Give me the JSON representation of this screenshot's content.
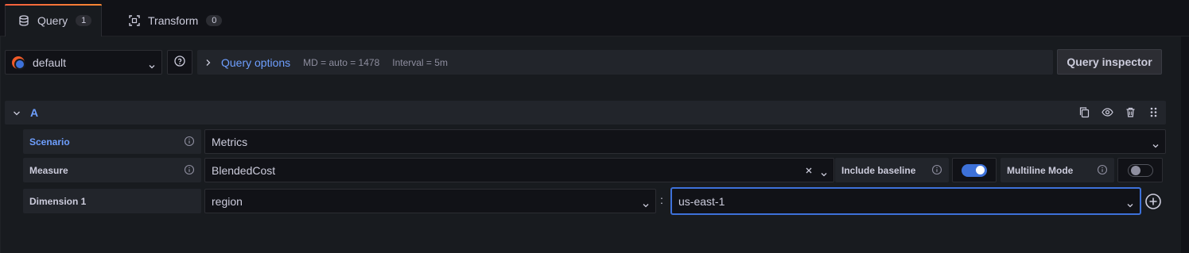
{
  "tabs": [
    {
      "label": "Query",
      "count": "1"
    },
    {
      "label": "Transform",
      "count": "0"
    }
  ],
  "toolbar": {
    "datasource": "default",
    "query_options_label": "Query options",
    "md": "MD = auto = 1478",
    "interval": "Interval = 5m",
    "inspector_label": "Query inspector"
  },
  "query": {
    "ref": "A",
    "rows": {
      "scenario": {
        "label": "Scenario",
        "value": "Metrics"
      },
      "measure": {
        "label": "Measure",
        "value": "BlendedCost"
      },
      "include_baseline": {
        "label": "Include baseline",
        "enabled": true
      },
      "multiline": {
        "label": "Multiline Mode",
        "enabled": false
      },
      "dimension": {
        "label": "Dimension 1",
        "key": "region",
        "separator": ":",
        "value": "us-east-1"
      }
    }
  },
  "colors": {
    "accent": "#6e9fff",
    "switch_on": "#3d71d9",
    "tab_gradient_start": "#f55f3e",
    "tab_gradient_end": "#ff8833"
  },
  "icons": [
    "database-icon",
    "transform-icon",
    "chevron-down-icon",
    "help-circle-icon",
    "chevron-right-icon",
    "copy-icon",
    "eye-icon",
    "trash-icon",
    "drag-handle-icon",
    "info-icon",
    "clear-icon",
    "plus-circle-icon"
  ]
}
